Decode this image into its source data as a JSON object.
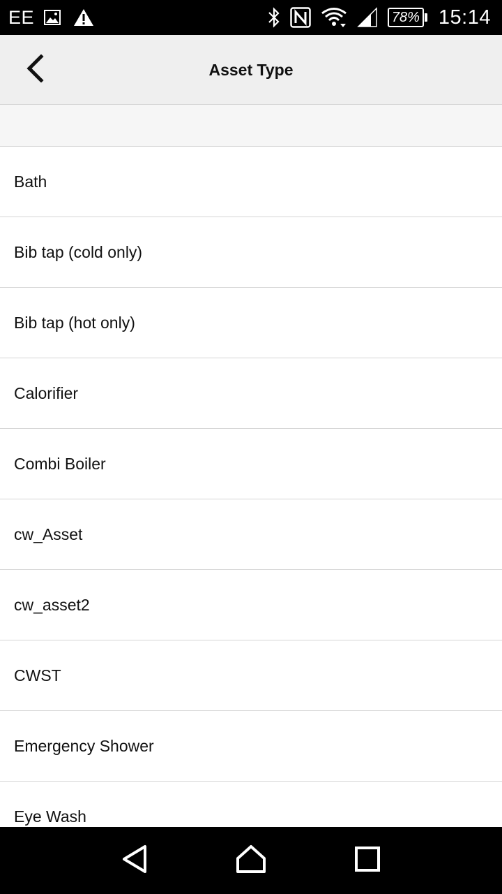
{
  "status_bar": {
    "carrier": "EE",
    "battery": "78%",
    "time": "15:14",
    "icons": [
      "image-icon",
      "warning-icon",
      "bluetooth-icon",
      "nfc-icon",
      "wifi-icon",
      "signal-icon",
      "battery-icon"
    ]
  },
  "header": {
    "title": "Asset Type",
    "back_icon": "chevron-left-icon"
  },
  "list": {
    "items": [
      {
        "label": "Bath"
      },
      {
        "label": "Bib tap (cold only)"
      },
      {
        "label": "Bib tap (hot only)"
      },
      {
        "label": "Calorifier"
      },
      {
        "label": "Combi Boiler"
      },
      {
        "label": "cw_Asset"
      },
      {
        "label": "cw_asset2"
      },
      {
        "label": "CWST"
      },
      {
        "label": "Emergency Shower"
      },
      {
        "label": "Eye Wash"
      }
    ]
  },
  "nav_bar": {
    "icons": [
      "back-triangle-icon",
      "home-icon",
      "recents-square-icon"
    ]
  },
  "colors": {
    "status_bar_bg": "#000000",
    "app_bar_bg": "#efefef",
    "divider": "#d6d6d6",
    "text": "#111111"
  }
}
